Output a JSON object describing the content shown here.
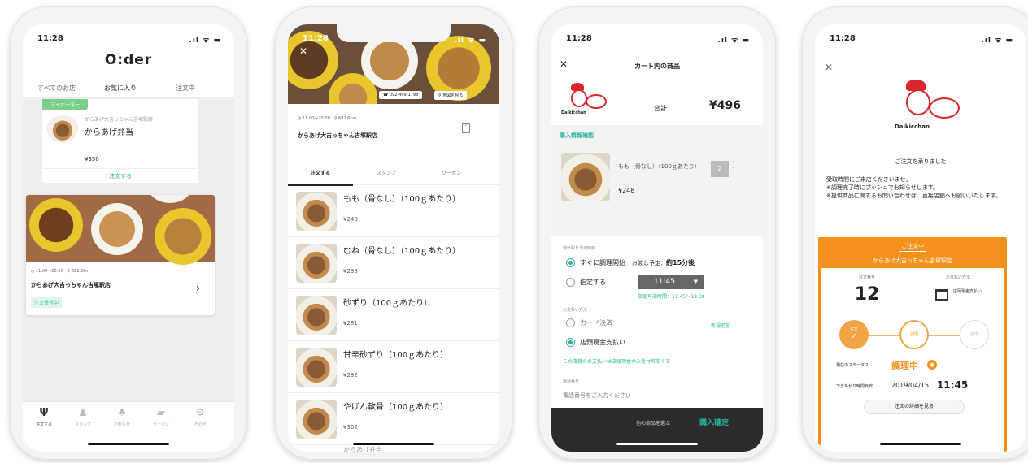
{
  "colors": {
    "teal": "#2bb39b",
    "orange": "#f2911b",
    "green_badge": "#7ccf8a",
    "dark_bar": "#2b2b2b"
  },
  "status_time": "11:28",
  "p1": {
    "logo": "O:der",
    "tabs": [
      "すべてのお店",
      "お気に入り",
      "注文中"
    ],
    "card1": {
      "badge": "マイオーダー",
      "store": "からあげ大吉っちゃん吉塚駅店",
      "item": "からあげ弁当",
      "price": "¥350",
      "order_label": "注文する"
    },
    "card2": {
      "hours": "11:00〜20:00",
      "distance": "682.6km",
      "store": "からあげ大吉っちゃん吉塚駅店",
      "status": "注文受付中",
      "chevron": "chevron-right-icon"
    },
    "tabbar": [
      {
        "label": "注文する",
        "icon": "fork-knife-icon",
        "glyph": "Ψ"
      },
      {
        "label": "スタンプ",
        "icon": "stamp-icon",
        "glyph": "♟"
      },
      {
        "label": "お知らせ",
        "icon": "bell-icon",
        "glyph": "♠"
      },
      {
        "label": "クーポン",
        "icon": "coupon-icon",
        "glyph": "▰"
      },
      {
        "label": "その他",
        "icon": "gear-icon",
        "glyph": "⚙"
      }
    ]
  },
  "p2": {
    "phone_btn": "092-409-1798",
    "map_btn": "地図を見る",
    "hours": "11:00〜20:00",
    "distance": "682.6km",
    "store": "からあげ大吉っちゃん吉塚駅店",
    "tabs": [
      "注文する",
      "スタンプ",
      "クーポン"
    ],
    "menu": [
      {
        "name": "もも（骨なし）（100ｇあたり）",
        "price": "¥248"
      },
      {
        "name": "むね（骨なし）（100ｇあたり）",
        "price": "¥238"
      },
      {
        "name": "砂ずり（100ｇあたり）",
        "price": "¥281"
      },
      {
        "name": "甘辛砂ずり（100ｇあたり）",
        "price": "¥292"
      },
      {
        "name": "やげん軟骨（100ｇあたり）",
        "price": "¥302"
      },
      {
        "name": "からあげ弁当",
        "price": ""
      }
    ]
  },
  "p3": {
    "title": "カート内の商品",
    "total_label": "合計",
    "total": "¥496",
    "brand": "Daikicchan",
    "confirm_heading": "購入情報確認",
    "item_name": "もも（骨なし）（100ｇあたり）",
    "item_price": "¥248",
    "qty": "2",
    "pickup_heading": "受け取り予定時刻",
    "asap": "すぐに調理開始",
    "eta_prefix": "お渡し予定：",
    "eta": "約15分後",
    "specify": "指定する",
    "time_value": "11:45",
    "time_range": "指定可能時間：11:45〜19:30",
    "payment_heading": "お支払い方法",
    "card": "カード決済",
    "new_add": "新規追加",
    "cash": "店頭現金支払い",
    "cash_note": "この店舗のお支払いは店頭現金のみ受付可能です",
    "phone_heading": "電話番号",
    "phone_placeholder": "電話番号をご入力ください",
    "other_items": "他の商品を選ぶ",
    "confirm_btn": "購入確定"
  },
  "p4": {
    "brand": "Daikicchan",
    "accepted": "ご注文を承りました",
    "message": "受取時間にご来店くださいませ。\n※調理完了時にプッシュでお知らせします。\n※提供商品に関するお問い合わせは、直接店舗へお願いいたします。",
    "card_title": "ご注文中",
    "store": "からあげ大吉っちゃん吉塚駅店",
    "order_no_label": "注文番号",
    "order_no": "12",
    "pay_label": "お支払い方法",
    "pay_value": "店頭現金支払い",
    "steps": [
      "注文",
      "調理",
      "完成"
    ],
    "current_status_label": "現在のステータス",
    "current_status": "調理中",
    "ready_label": "できあがり時間目安",
    "ready_date": "2019/04/15",
    "ready_time": "11:45",
    "detail_btn": "注文の詳細を見る"
  }
}
